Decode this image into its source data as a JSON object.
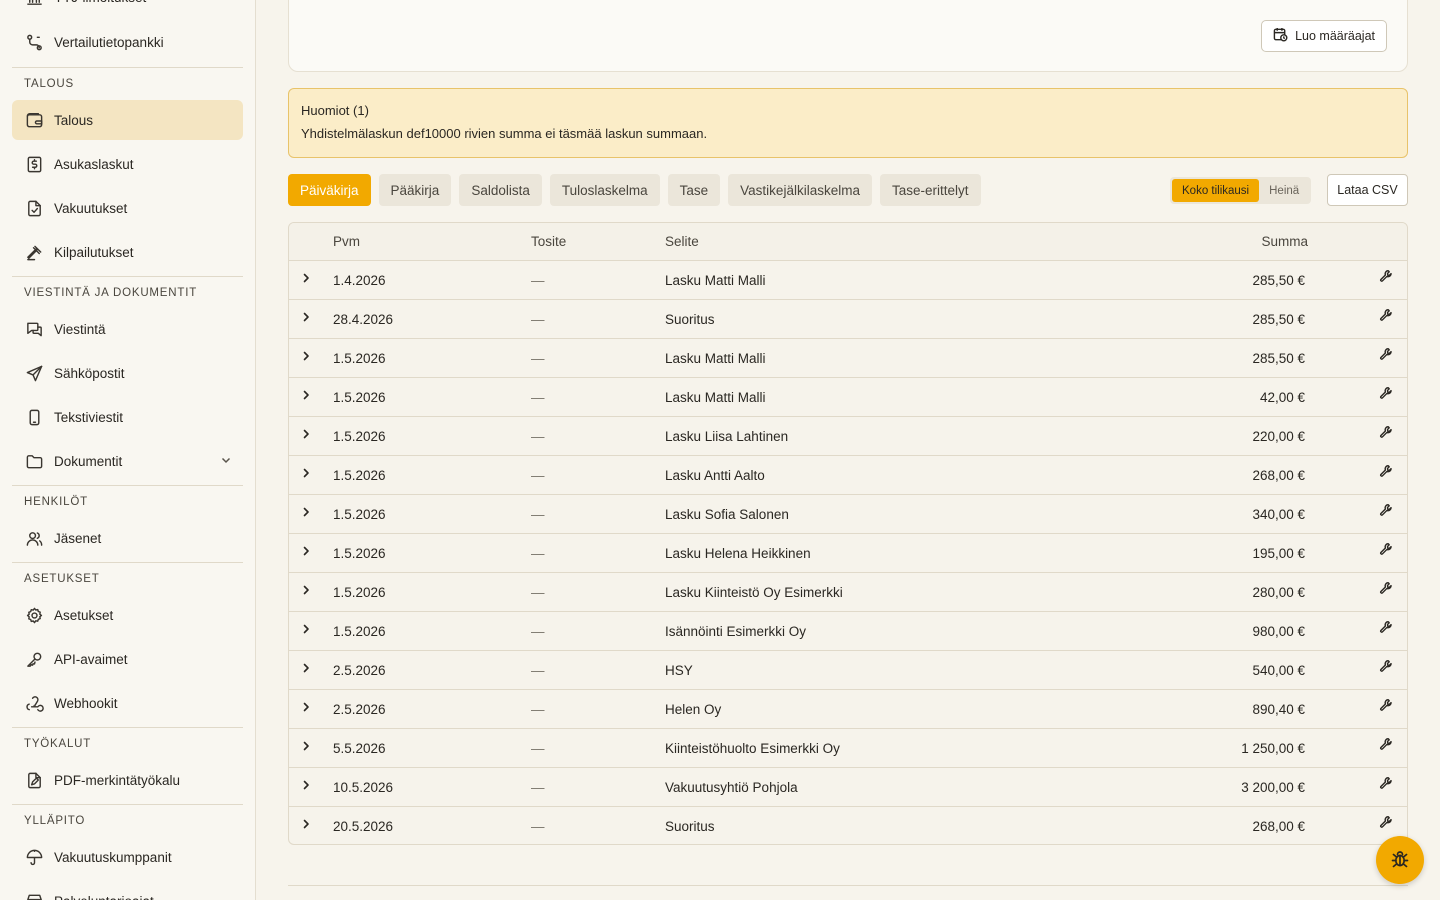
{
  "sidebar": {
    "items_top": [
      {
        "label": "YTJ-ilmoitukset",
        "icon": "bank-icon"
      },
      {
        "label": "Vertailutietopankki",
        "icon": "route-icon"
      }
    ],
    "sections": [
      {
        "heading": "TALOUS",
        "items": [
          {
            "label": "Talous",
            "icon": "wallet-icon",
            "active": true
          },
          {
            "label": "Asukaslaskut",
            "icon": "receipt-icon"
          },
          {
            "label": "Vakuutukset",
            "icon": "file-check-icon"
          },
          {
            "label": "Kilpailutukset",
            "icon": "gavel-icon"
          }
        ]
      },
      {
        "heading": "VIESTINTÄ JA DOKUMENTIT",
        "items": [
          {
            "label": "Viestintä",
            "icon": "messages-icon"
          },
          {
            "label": "Sähköpostit",
            "icon": "send-icon"
          },
          {
            "label": "Tekstiviestit",
            "icon": "phone-icon"
          },
          {
            "label": "Dokumentit",
            "icon": "folder-icon",
            "expandable": true
          }
        ]
      },
      {
        "heading": "HENKILÖT",
        "items": [
          {
            "label": "Jäsenet",
            "icon": "users-icon"
          }
        ]
      },
      {
        "heading": "ASETUKSET",
        "items": [
          {
            "label": "Asetukset",
            "icon": "gear-icon"
          },
          {
            "label": "API-avaimet",
            "icon": "key-icon"
          },
          {
            "label": "Webhookit",
            "icon": "webhook-icon"
          }
        ]
      },
      {
        "heading": "TYÖKALUT",
        "items": [
          {
            "label": "PDF-merkintätyökalu",
            "icon": "pdf-edit-icon"
          }
        ]
      },
      {
        "heading": "YLLÄPITO",
        "items": [
          {
            "label": "Vakuutuskumppanit",
            "icon": "umbrella-icon"
          },
          {
            "label": "Palveluntarjoajat",
            "icon": "store-icon"
          }
        ]
      }
    ]
  },
  "top_card": {
    "deadlines_button": "Luo määräajat"
  },
  "notice": {
    "title": "Huomiot (1)",
    "text": "Yhdistelmälaskun def10000 rivien summa ei täsmää laskun summaan."
  },
  "tabs": [
    "Päiväkirja",
    "Pääkirja",
    "Saldolista",
    "Tuloslaskelma",
    "Tase",
    "Vastikejälkilaskelma",
    "Tase-erittelyt"
  ],
  "active_tab": "Päiväkirja",
  "range": {
    "options": [
      "Koko tilikausi",
      "Heinä"
    ],
    "selected": "Koko tilikausi"
  },
  "csv_button": "Lataa CSV",
  "table": {
    "headers": {
      "date": "Pvm",
      "voucher": "Tosite",
      "description": "Selite",
      "amount": "Summa"
    },
    "rows": [
      {
        "date": "1.4.2026",
        "voucher": "—",
        "description": "Lasku Matti Malli",
        "amount": "285,50 €"
      },
      {
        "date": "28.4.2026",
        "voucher": "—",
        "description": "Suoritus",
        "amount": "285,50 €"
      },
      {
        "date": "1.5.2026",
        "voucher": "—",
        "description": "Lasku Matti Malli",
        "amount": "285,50 €"
      },
      {
        "date": "1.5.2026",
        "voucher": "—",
        "description": "Lasku Matti Malli",
        "amount": "42,00 €"
      },
      {
        "date": "1.5.2026",
        "voucher": "—",
        "description": "Lasku Liisa Lahtinen",
        "amount": "220,00 €"
      },
      {
        "date": "1.5.2026",
        "voucher": "—",
        "description": "Lasku Antti Aalto",
        "amount": "268,00 €"
      },
      {
        "date": "1.5.2026",
        "voucher": "—",
        "description": "Lasku Sofia Salonen",
        "amount": "340,00 €"
      },
      {
        "date": "1.5.2026",
        "voucher": "—",
        "description": "Lasku Helena Heikkinen",
        "amount": "195,00 €"
      },
      {
        "date": "1.5.2026",
        "voucher": "—",
        "description": "Lasku Kiinteistö Oy Esimerkki",
        "amount": "280,00 €"
      },
      {
        "date": "1.5.2026",
        "voucher": "—",
        "description": "Isännöinti Esimerkki Oy",
        "amount": "980,00 €"
      },
      {
        "date": "2.5.2026",
        "voucher": "—",
        "description": "HSY",
        "amount": "540,00 €"
      },
      {
        "date": "2.5.2026",
        "voucher": "—",
        "description": "Helen Oy",
        "amount": "890,40 €"
      },
      {
        "date": "5.5.2026",
        "voucher": "—",
        "description": "Kiinteistöhuolto Esimerkki Oy",
        "amount": "1 250,00 €"
      },
      {
        "date": "10.5.2026",
        "voucher": "—",
        "description": "Vakuutusyhtiö Pohjola",
        "amount": "3 200,00 €"
      },
      {
        "date": "20.5.2026",
        "voucher": "—",
        "description": "Suoritus",
        "amount": "268,00 €"
      }
    ]
  },
  "colors": {
    "accent": "#f2a900",
    "active_nav": "#f4e5c2",
    "notice_bg": "#fbedc8",
    "notice_border": "#e8c36a"
  }
}
